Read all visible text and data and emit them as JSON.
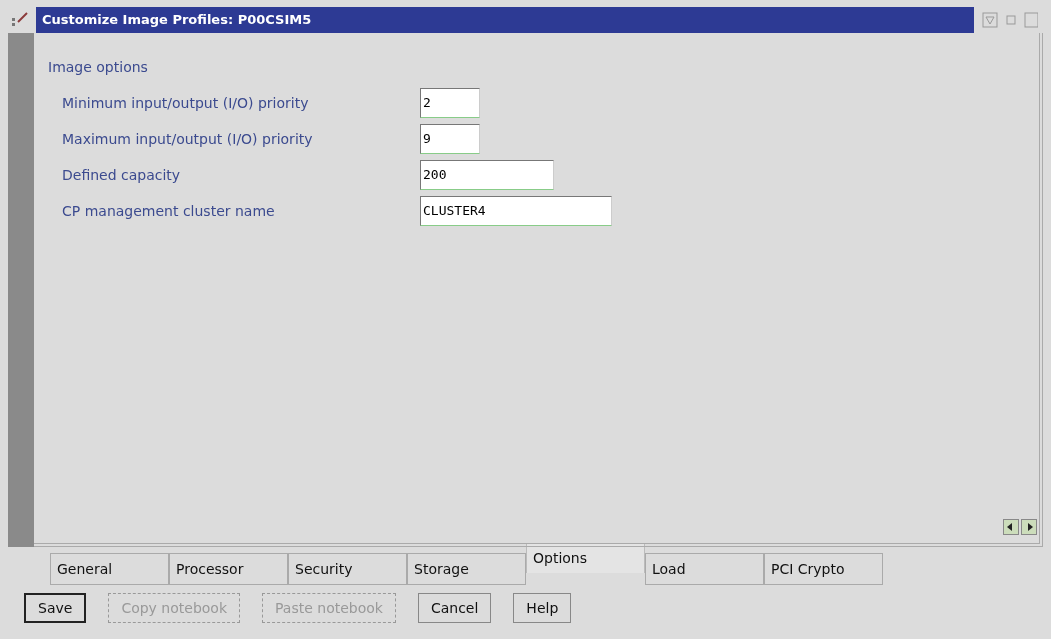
{
  "window": {
    "title": "Customize Image Profiles: P00CSIM5"
  },
  "section": {
    "title": "Image options"
  },
  "fields": [
    {
      "label": "Minimum input/output (I/O) priority",
      "value": "2"
    },
    {
      "label": "Maximum input/output (I/O) priority",
      "value": "9"
    },
    {
      "label": "Defined capacity",
      "value": "200"
    },
    {
      "label": "CP management cluster name",
      "value": "CLUSTER4"
    }
  ],
  "tabs": [
    {
      "label": "General",
      "selected": false
    },
    {
      "label": "Processor",
      "selected": false
    },
    {
      "label": "Security",
      "selected": false
    },
    {
      "label": "Storage",
      "selected": false
    },
    {
      "label": "Options",
      "selected": true
    },
    {
      "label": "Load",
      "selected": false
    },
    {
      "label": "PCI Crypto",
      "selected": false
    }
  ],
  "buttons": [
    {
      "label": "Save",
      "default": true,
      "disabled": false
    },
    {
      "label": "Copy notebook",
      "default": false,
      "disabled": true
    },
    {
      "label": "Paste notebook",
      "default": false,
      "disabled": true
    },
    {
      "label": "Cancel",
      "default": false,
      "disabled": false
    },
    {
      "label": "Help",
      "default": false,
      "disabled": false
    }
  ]
}
